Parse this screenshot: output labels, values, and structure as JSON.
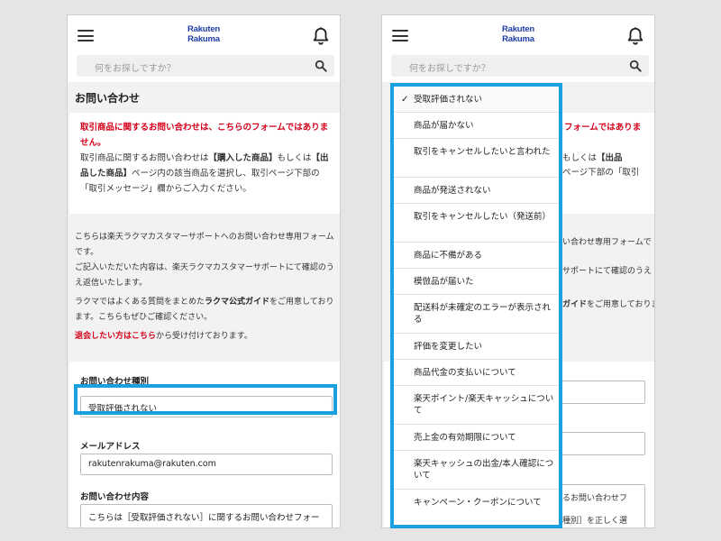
{
  "header": {
    "logo_line1": "Rakuten",
    "logo_line2": "Rakuma",
    "search_placeholder": "何をお探しですか？"
  },
  "page": {
    "title": "お問い合わせ"
  },
  "notice": {
    "red_text": "取引商品に関するお問い合わせは、こちらのフォームではありません。",
    "body_1": "取引商品に関するお問い合わせは",
    "body_bold_1": "【購入した商品】",
    "body_2": "もしくは",
    "body_bold_2": "【出品した商品】",
    "body_3": "ページ内の該当商品を選択し、取引ページ下部の「取引メッセージ」欄からご入力ください。"
  },
  "info": {
    "p1": "こちらは楽天ラクマカスタマーサポートへのお問い合わせ専用フォームです。",
    "p2": "ご記入いただいた内容は、楽天ラクマカスタマーサポートにて確認のうえ返信いたします。",
    "p3_a": "ラクマではよくある質問をまとめた",
    "p3_bold": "ラクマ公式ガイド",
    "p3_b": "をご用意しております。こちらもぜひご確認ください。",
    "p4_link": "退会したい方はこちら",
    "p4_rest": "から受け付けております。"
  },
  "form": {
    "type_label": "お問い合わせ種別",
    "type_value": "受取評価されない",
    "email_label": "メールアドレス",
    "email_value": "rakutenrakuma@rakuten.com",
    "content_label": "お問い合わせ内容",
    "content_value": "こちらは［受取評価されない］に関するお問い合わせフォーマットです。"
  },
  "dropdown": {
    "check_mark": "✓",
    "options": [
      "受取評価されない",
      "商品が届かない",
      "取引をキャンセルしたいと言われた",
      "商品が発送されない",
      "取引をキャンセルしたい（発送前）",
      "商品に不備がある",
      "模倣品が届いた",
      "配送料が未確定のエラーが表示される",
      "評価を変更したい",
      "商品代金の支払いについて",
      "楽天ポイント/楽天キャッシュについて",
      "売上金の有効期限について",
      "楽天キャッシュの出金/本人確認について",
      "キャンペーン・クーポンについて"
    ]
  },
  "right_background": {
    "notice_red_fragment": "フォームではありま",
    "notice_fragment_1": "【出品",
    "notice_fragment_1_prefix": "もしくは",
    "notice_fragment_2": "部の「取引",
    "notice_fragment_2_prefix": "ページ下",
    "info_fragment_1": "い合わせ専用フォームで",
    "info_fragment_2": "サポートにて確認のうえ",
    "info_fragment_3": "をご用意しておりま",
    "info_fragment_3_bold": "ガイド",
    "content_fragment_1": "るお問い合わせフ",
    "content_fragment_2": "種別］を正しく選"
  },
  "colors": {
    "highlight": "#1aa0e0",
    "alert_red": "#d4001a",
    "logo_blue": "#1f3da8"
  },
  "icons": {
    "menu": "hamburger-icon",
    "notification": "bell-icon",
    "search": "search-icon",
    "selected": "check-icon"
  }
}
